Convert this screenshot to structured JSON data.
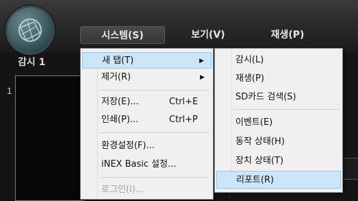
{
  "menubar": {
    "system": "시스템(S)",
    "view": "보기(V)",
    "playback": "재생(P)"
  },
  "monitor_label": "감시 1",
  "panel_number": "1",
  "system_menu": {
    "new_tab": "새 탭(T)",
    "remove": "제거(R)",
    "save": "저장(E)...",
    "save_shortcut": "Ctrl+E",
    "print": "인쇄(P)...",
    "print_shortcut": "Ctrl+P",
    "settings": "환경설정(F)...",
    "inex_settings": "iNEX Basic 설정...",
    "login": "로그인(I)..."
  },
  "new_tab_submenu": [
    "감시(L)",
    "재생(P)",
    "SD카드 검색(S)",
    "이벤트(E)",
    "동작 상태(H)",
    "장치 상태(T)",
    "리포트(R)"
  ],
  "colors": {
    "highlight": "#cde6f7",
    "menu_bg": "#f0f0f0",
    "app_bg": "#141414"
  }
}
